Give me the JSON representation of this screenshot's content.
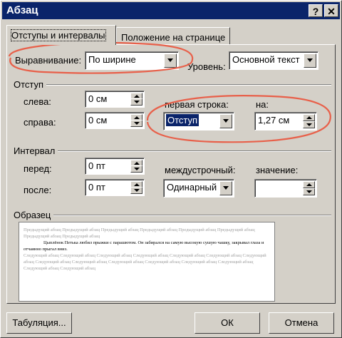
{
  "dialog": {
    "title": "Абзац",
    "help_glyph": "?",
    "close_glyph": "✕"
  },
  "tabs": [
    {
      "label": "Отступы и интервалы"
    },
    {
      "label": "Положение на странице"
    }
  ],
  "general": {
    "alignment_label": "Выравнивание:",
    "alignment_value": "По ширине",
    "level_label": "Уровень:",
    "level_value": "Основной текст"
  },
  "indent": {
    "group_label": "Отступ",
    "left_label": "слева:",
    "left_value": "0 см",
    "right_label": "справа:",
    "right_value": "0 см",
    "first_line_label": "первая строка:",
    "first_line_value": "Отступ",
    "by_label": "на:",
    "by_value": "1,27 см"
  },
  "spacing": {
    "group_label": "Интервал",
    "before_label": "перед:",
    "before_value": "0 пт",
    "after_label": "после:",
    "after_value": "0 пт",
    "line_label": "междустрочный:",
    "line_value": "Одинарный",
    "at_label": "значение:",
    "at_value": ""
  },
  "preview": {
    "group_label": "Образец",
    "prev_para": "Предыдущий абзац Предыдущий абзац Предыдущий абзац Предыдущий абзац Предыдущий абзац Предыдущий абзац Предыдущий абзац Предыдущий абзац",
    "current_para": "Цыплёнок Петька любил прыжки с парашютом. Он забирался на самую высокую сушую чашку, закрывал глаза и отчаянно прыгал вниз.",
    "next_para": "Следующий абзац Следующий абзац Следующий абзац Следующий абзац Следующий абзац Следующий абзац Следующий абзац Следующий абзац Следующий абзац Следующий абзац Следующий абзац Следующий абзац Следующий абзац Следующий абзац Следующий абзац"
  },
  "buttons": {
    "tabs_label": "Табуляция...",
    "ok_label": "ОК",
    "cancel_label": "Отмена"
  },
  "colors": {
    "title_bar": "#0a246a",
    "annotation": "#e8604a",
    "face": "#d4d0c8"
  }
}
